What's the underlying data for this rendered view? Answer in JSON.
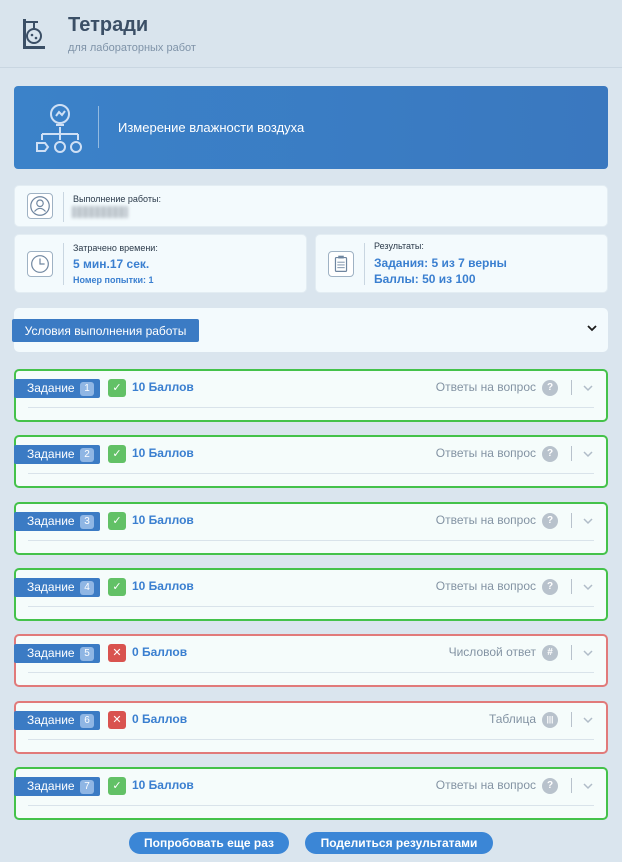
{
  "app": {
    "title": "Тетради",
    "subtitle": "для лабораторных работ",
    "logo_icon": "flask-icon"
  },
  "banner": {
    "title": "Измерение влажности воздуха",
    "icon": "lightbulb-workflow-icon"
  },
  "execution": {
    "label": "Выполнение работы:",
    "icon": "user-icon"
  },
  "time": {
    "label": "Затрачено времени:",
    "value": "5 мин.17 сек.",
    "attempt": "Номер попытки: 1",
    "icon": "clock-icon"
  },
  "results": {
    "label": "Результаты:",
    "tasks": "Задания: 5 из 7 верны",
    "points": "Баллы: 50 из 100",
    "icon": "clipboard-icon"
  },
  "conditions": {
    "label": "Условия выполнения работы",
    "icon": "chevron-down-icon"
  },
  "tasks": [
    {
      "label": "Задание",
      "number": "1",
      "status": "correct",
      "mark": "✓",
      "points": "10 Баллов",
      "type": "Ответы на вопрос",
      "type_symbol": "?"
    },
    {
      "label": "Задание",
      "number": "2",
      "status": "correct",
      "mark": "✓",
      "points": "10 Баллов",
      "type": "Ответы на вопрос",
      "type_symbol": "?"
    },
    {
      "label": "Задание",
      "number": "3",
      "status": "correct",
      "mark": "✓",
      "points": "10 Баллов",
      "type": "Ответы на вопрос",
      "type_symbol": "?"
    },
    {
      "label": "Задание",
      "number": "4",
      "status": "correct",
      "mark": "✓",
      "points": "10 Баллов",
      "type": "Ответы на вопрос",
      "type_symbol": "?"
    },
    {
      "label": "Задание",
      "number": "5",
      "status": "wrong",
      "mark": "✕",
      "points": "0 Баллов",
      "type": "Числовой ответ",
      "type_symbol": "#"
    },
    {
      "label": "Задание",
      "number": "6",
      "status": "wrong",
      "mark": "✕",
      "points": "0 Баллов",
      "type": "Таблица",
      "type_symbol": "|||"
    },
    {
      "label": "Задание",
      "number": "7",
      "status": "correct",
      "mark": "✓",
      "points": "10 Баллов",
      "type": "Ответы на вопрос",
      "type_symbol": "?"
    }
  ],
  "actions": {
    "retry": "Попробовать еще раз",
    "share": "Поделиться результатами"
  },
  "colors": {
    "accent": "#3b7bc4",
    "correct_border": "#44c24a",
    "wrong_border": "#e17a7a",
    "correct_badge": "#62c166",
    "wrong_badge": "#d9534f"
  }
}
